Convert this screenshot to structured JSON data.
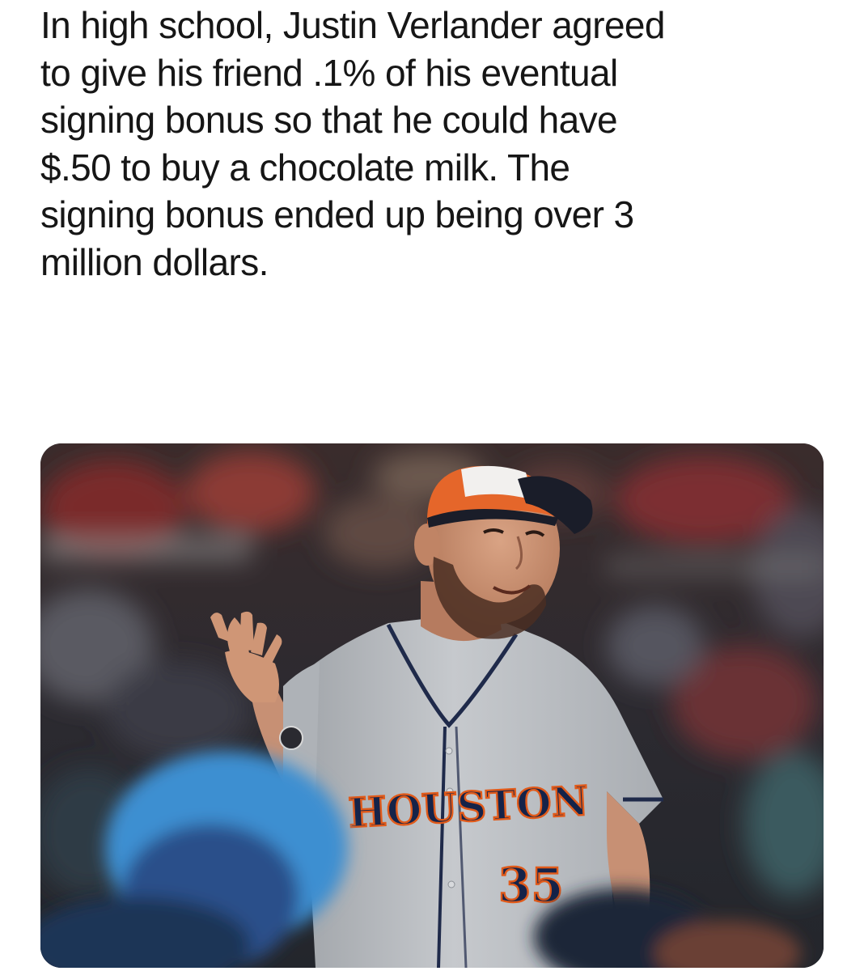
{
  "post": {
    "text_lines": [
      "In high school, Justin Verlander agreed",
      "to give his friend .1% of his eventual",
      "signing bonus so that he could have",
      "$.50 to buy a chocolate milk. The",
      "signing bonus ended up being over 3",
      "million dollars."
    ]
  },
  "photo": {
    "jersey_lettering": "HOUSTON",
    "jersey_number": "35",
    "colors": {
      "jersey": "#b9bcc0",
      "piping": "#1f2a4a",
      "lettering": "#152349",
      "lettering_outline": "#e05a1a",
      "cap_orange": "#e5662a",
      "cap_navy": "#1a1d29",
      "foreground_cap": "#3d8fd1"
    }
  }
}
